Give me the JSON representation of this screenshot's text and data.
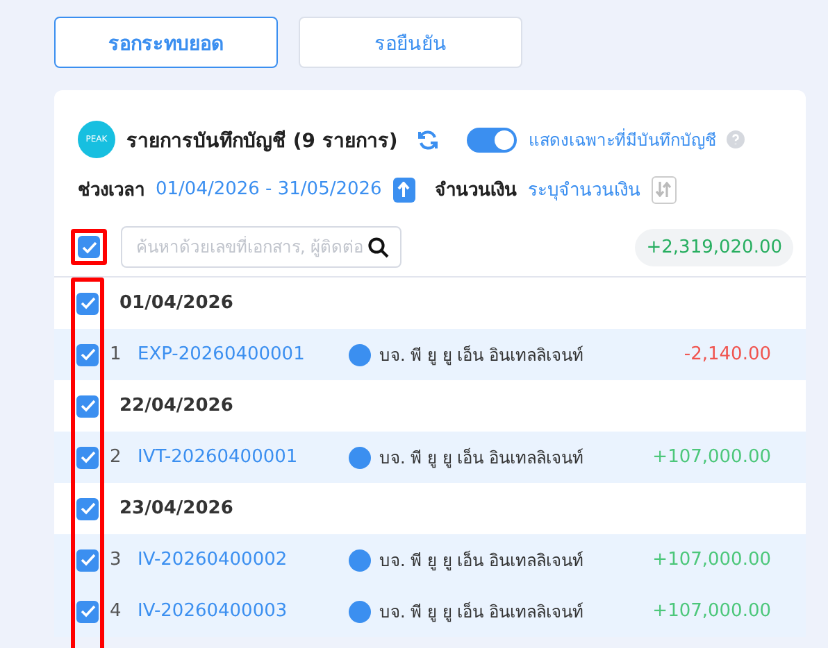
{
  "tabs": [
    {
      "label": "รอกระทบยอด",
      "selected": true
    },
    {
      "label": "รอยืนยัน",
      "selected": false
    }
  ],
  "panel": {
    "logo_text": "PEAK",
    "title": "รายการบันทึกบัญชี (9 รายการ)",
    "toggle": {
      "on": true,
      "label": "แสดงเฉพาะที่มีบันทึกบัญชี"
    },
    "period_label": "ช่วงเวลา",
    "period_value": "01/04/2026 - 31/05/2026",
    "amount_label": "จำนวนเงิน",
    "amount_value": "ระบุจำนวนเงิน",
    "select_all": {
      "checked": true,
      "highlighted": true
    },
    "search": {
      "placeholder": "ค้นหาด้วยเลขที่เอกสาร, ผู้ติดต่อ"
    },
    "total": "+2,319,020.00",
    "list_highlighted": true,
    "rows": [
      {
        "kind": "date",
        "checked": true,
        "date": "01/04/2026"
      },
      {
        "kind": "entry",
        "checked": true,
        "index": "1",
        "doc": "EXP-20260400001",
        "contact": "บจ. พี ยู ยู เอ็น อินเทลลิเจนท์",
        "amount": "-2,140.00",
        "color": "#f0544f"
      },
      {
        "kind": "date",
        "checked": true,
        "date": "22/04/2026"
      },
      {
        "kind": "entry",
        "checked": true,
        "index": "2",
        "doc": "IVT-20260400001",
        "contact": "บจ. พี ยู ยู เอ็น อินเทลลิเจนท์",
        "amount": "+107,000.00",
        "color": "#4cc77a"
      },
      {
        "kind": "date",
        "checked": true,
        "date": "23/04/2026"
      },
      {
        "kind": "entry",
        "checked": true,
        "index": "3",
        "doc": "IV-20260400002",
        "contact": "บจ. พี ยู ยู เอ็น อินเทลลิเจนท์",
        "amount": "+107,000.00",
        "color": "#4cc77a"
      },
      {
        "kind": "entry",
        "checked": true,
        "index": "4",
        "doc": "IV-20260400003",
        "contact": "บจ. พี ยู ยู เอ็น อินเทลลิเจนท์",
        "amount": "+107,000.00",
        "color": "#4cc77a"
      }
    ]
  }
}
